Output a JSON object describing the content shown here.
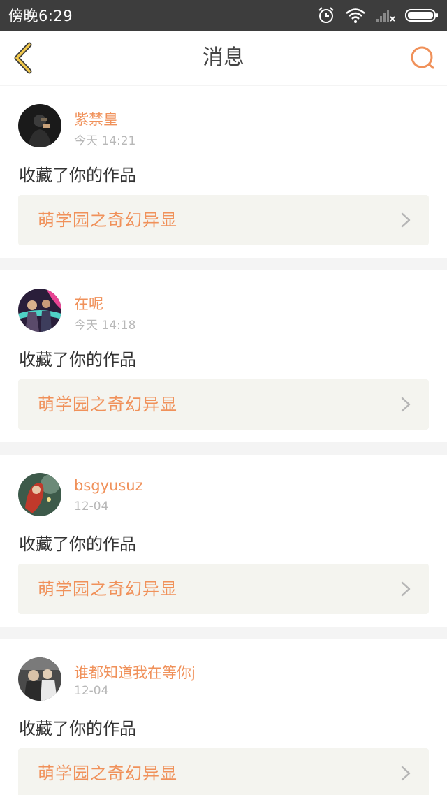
{
  "status_bar": {
    "time": "傍晚6:29",
    "icons": [
      "alarm-icon",
      "wifi-icon",
      "signal-icon",
      "battery-icon"
    ]
  },
  "header": {
    "title": "消息",
    "back_icon": "chevron-left-icon",
    "search_icon": "search-icon",
    "accent_color": "#f0915a",
    "back_color": "#f2c94c"
  },
  "messages": [
    {
      "username": "紫禁皇",
      "time": "今天 14:21",
      "action": "收藏了你的作品",
      "work_title": "萌学园之奇幻异显"
    },
    {
      "username": "在呢",
      "time": "今天 14:18",
      "action": "收藏了你的作品",
      "work_title": "萌学园之奇幻异显"
    },
    {
      "username": "bsgyusuz",
      "time": "12-04",
      "action": "收藏了你的作品",
      "work_title": "萌学园之奇幻异显"
    },
    {
      "username": "谁都知道我在等你j",
      "time": "12-04",
      "action": "收藏了你的作品",
      "work_title": "萌学园之奇幻异显"
    }
  ]
}
